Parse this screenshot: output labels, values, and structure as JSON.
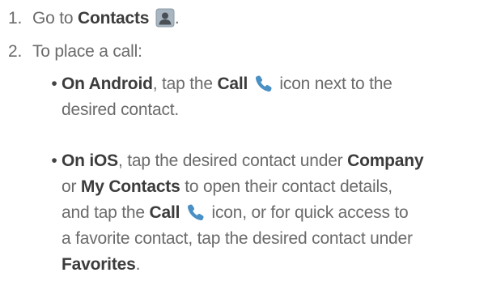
{
  "steps": [
    {
      "number": "1.",
      "prefix": "Go to ",
      "bold": "Contacts",
      "icon": "contacts-icon",
      "suffix": "."
    },
    {
      "number": "2.",
      "text": "To place a call:"
    }
  ],
  "bullets": {
    "android": {
      "platform": "On Android",
      "line1_a": ", tap the ",
      "call_label": "Call",
      "line1_b": " icon next to the",
      "line2": "desired contact."
    },
    "ios": {
      "platform": "On iOS",
      "line1_a": ", tap the desired contact under ",
      "company_label": "Company",
      "line2_bold": "My Contacts",
      "line2_prefix": "or ",
      "line2_suffix": " to open their contact details,",
      "line3_a": "and tap the ",
      "call_label": "Call",
      "line3_b": " icon, or for quick access to",
      "line4": "a favorite contact, tap the desired contact under",
      "line5_bold": "Favorites",
      "line5_suffix": "."
    }
  },
  "colors": {
    "text": "#6b6b6b",
    "bold_text": "#3c3c3c",
    "call_icon": "#4a90c4",
    "contacts_icon_bg": "#a8b6c2"
  },
  "icons": [
    "contacts-icon",
    "call-icon"
  ]
}
